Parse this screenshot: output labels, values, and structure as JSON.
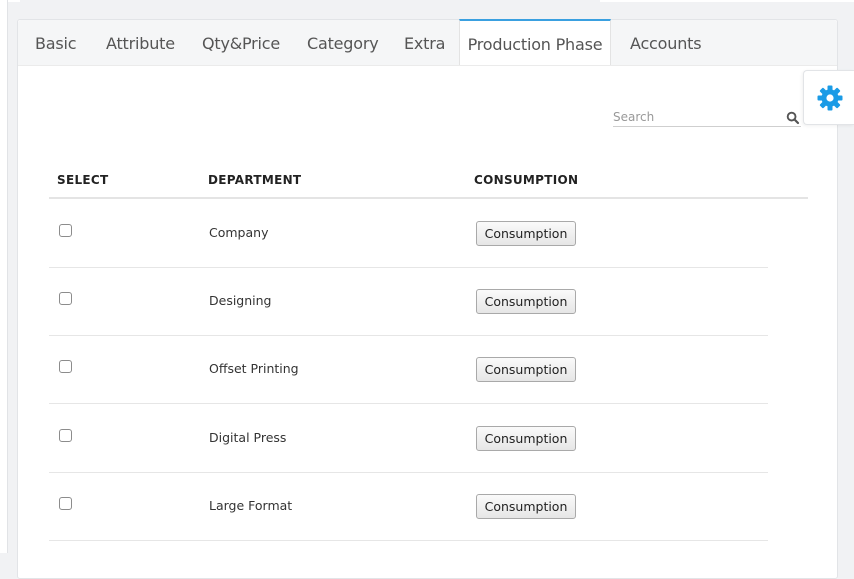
{
  "tabs": [
    {
      "label": "Basic"
    },
    {
      "label": "Attribute"
    },
    {
      "label": "Qty&Price"
    },
    {
      "label": "Category"
    },
    {
      "label": "Extra"
    },
    {
      "label": "Production Phase",
      "active": true
    },
    {
      "label": "Accounts"
    }
  ],
  "search": {
    "placeholder": "Search",
    "value": ""
  },
  "table": {
    "headers": {
      "select": "SELECT",
      "department": "DEPARTMENT",
      "consumption": "CONSUMPTION"
    },
    "rows": [
      {
        "department": "Company",
        "button_label": "Consumption",
        "selected": false
      },
      {
        "department": "Designing",
        "button_label": "Consumption",
        "selected": false
      },
      {
        "department": "Offset Printing",
        "button_label": "Consumption",
        "selected": false
      },
      {
        "department": "Digital Press",
        "button_label": "Consumption",
        "selected": false
      },
      {
        "department": "Large Format",
        "button_label": "Consumption",
        "selected": false
      }
    ]
  },
  "icons": {
    "search": "search-icon",
    "settings": "gear-icon"
  },
  "colors": {
    "active_tab_accent": "#3aa0e0",
    "gear": "#1a9be6"
  }
}
